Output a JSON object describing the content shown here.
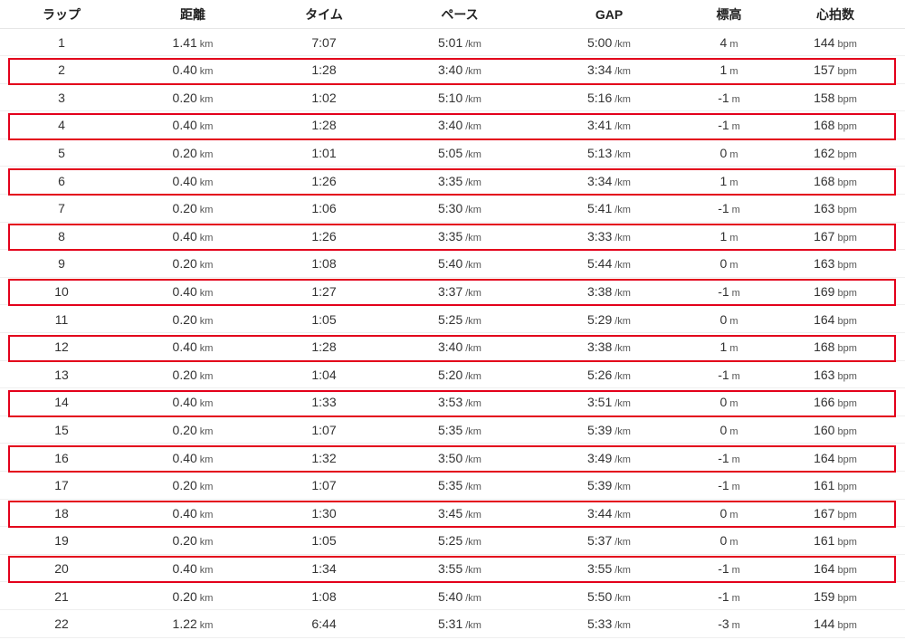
{
  "table": {
    "headers": {
      "lap": "ラップ",
      "distance": "距離",
      "time": "タイム",
      "pace": "ペース",
      "gap": "GAP",
      "elevation": "標高",
      "heart_rate": "心拍数"
    },
    "units": {
      "distance": "km",
      "pace": "/km",
      "gap": "/km",
      "elevation": "m",
      "heart_rate": "bpm"
    },
    "highlight_color": "#e3001b",
    "rows": [
      {
        "lap": "1",
        "distance": "1.41",
        "time": "7:07",
        "pace": "5:01",
        "gap": "5:00",
        "elevation": "4",
        "heart_rate": "144",
        "highlighted": false
      },
      {
        "lap": "2",
        "distance": "0.40",
        "time": "1:28",
        "pace": "3:40",
        "gap": "3:34",
        "elevation": "1",
        "heart_rate": "157",
        "highlighted": true
      },
      {
        "lap": "3",
        "distance": "0.20",
        "time": "1:02",
        "pace": "5:10",
        "gap": "5:16",
        "elevation": "-1",
        "heart_rate": "158",
        "highlighted": false
      },
      {
        "lap": "4",
        "distance": "0.40",
        "time": "1:28",
        "pace": "3:40",
        "gap": "3:41",
        "elevation": "-1",
        "heart_rate": "168",
        "highlighted": true
      },
      {
        "lap": "5",
        "distance": "0.20",
        "time": "1:01",
        "pace": "5:05",
        "gap": "5:13",
        "elevation": "0",
        "heart_rate": "162",
        "highlighted": false
      },
      {
        "lap": "6",
        "distance": "0.40",
        "time": "1:26",
        "pace": "3:35",
        "gap": "3:34",
        "elevation": "1",
        "heart_rate": "168",
        "highlighted": true
      },
      {
        "lap": "7",
        "distance": "0.20",
        "time": "1:06",
        "pace": "5:30",
        "gap": "5:41",
        "elevation": "-1",
        "heart_rate": "163",
        "highlighted": false
      },
      {
        "lap": "8",
        "distance": "0.40",
        "time": "1:26",
        "pace": "3:35",
        "gap": "3:33",
        "elevation": "1",
        "heart_rate": "167",
        "highlighted": true
      },
      {
        "lap": "9",
        "distance": "0.20",
        "time": "1:08",
        "pace": "5:40",
        "gap": "5:44",
        "elevation": "0",
        "heart_rate": "163",
        "highlighted": false
      },
      {
        "lap": "10",
        "distance": "0.40",
        "time": "1:27",
        "pace": "3:37",
        "gap": "3:38",
        "elevation": "-1",
        "heart_rate": "169",
        "highlighted": true
      },
      {
        "lap": "11",
        "distance": "0.20",
        "time": "1:05",
        "pace": "5:25",
        "gap": "5:29",
        "elevation": "0",
        "heart_rate": "164",
        "highlighted": false
      },
      {
        "lap": "12",
        "distance": "0.40",
        "time": "1:28",
        "pace": "3:40",
        "gap": "3:38",
        "elevation": "1",
        "heart_rate": "168",
        "highlighted": true
      },
      {
        "lap": "13",
        "distance": "0.20",
        "time": "1:04",
        "pace": "5:20",
        "gap": "5:26",
        "elevation": "-1",
        "heart_rate": "163",
        "highlighted": false
      },
      {
        "lap": "14",
        "distance": "0.40",
        "time": "1:33",
        "pace": "3:53",
        "gap": "3:51",
        "elevation": "0",
        "heart_rate": "166",
        "highlighted": true
      },
      {
        "lap": "15",
        "distance": "0.20",
        "time": "1:07",
        "pace": "5:35",
        "gap": "5:39",
        "elevation": "0",
        "heart_rate": "160",
        "highlighted": false
      },
      {
        "lap": "16",
        "distance": "0.40",
        "time": "1:32",
        "pace": "3:50",
        "gap": "3:49",
        "elevation": "-1",
        "heart_rate": "164",
        "highlighted": true
      },
      {
        "lap": "17",
        "distance": "0.20",
        "time": "1:07",
        "pace": "5:35",
        "gap": "5:39",
        "elevation": "-1",
        "heart_rate": "161",
        "highlighted": false
      },
      {
        "lap": "18",
        "distance": "0.40",
        "time": "1:30",
        "pace": "3:45",
        "gap": "3:44",
        "elevation": "0",
        "heart_rate": "167",
        "highlighted": true
      },
      {
        "lap": "19",
        "distance": "0.20",
        "time": "1:05",
        "pace": "5:25",
        "gap": "5:37",
        "elevation": "0",
        "heart_rate": "161",
        "highlighted": false
      },
      {
        "lap": "20",
        "distance": "0.40",
        "time": "1:34",
        "pace": "3:55",
        "gap": "3:55",
        "elevation": "-1",
        "heart_rate": "164",
        "highlighted": true
      },
      {
        "lap": "21",
        "distance": "0.20",
        "time": "1:08",
        "pace": "5:40",
        "gap": "5:50",
        "elevation": "-1",
        "heart_rate": "159",
        "highlighted": false
      },
      {
        "lap": "22",
        "distance": "1.22",
        "time": "6:44",
        "pace": "5:31",
        "gap": "5:33",
        "elevation": "-3",
        "heart_rate": "144",
        "highlighted": false
      }
    ]
  }
}
